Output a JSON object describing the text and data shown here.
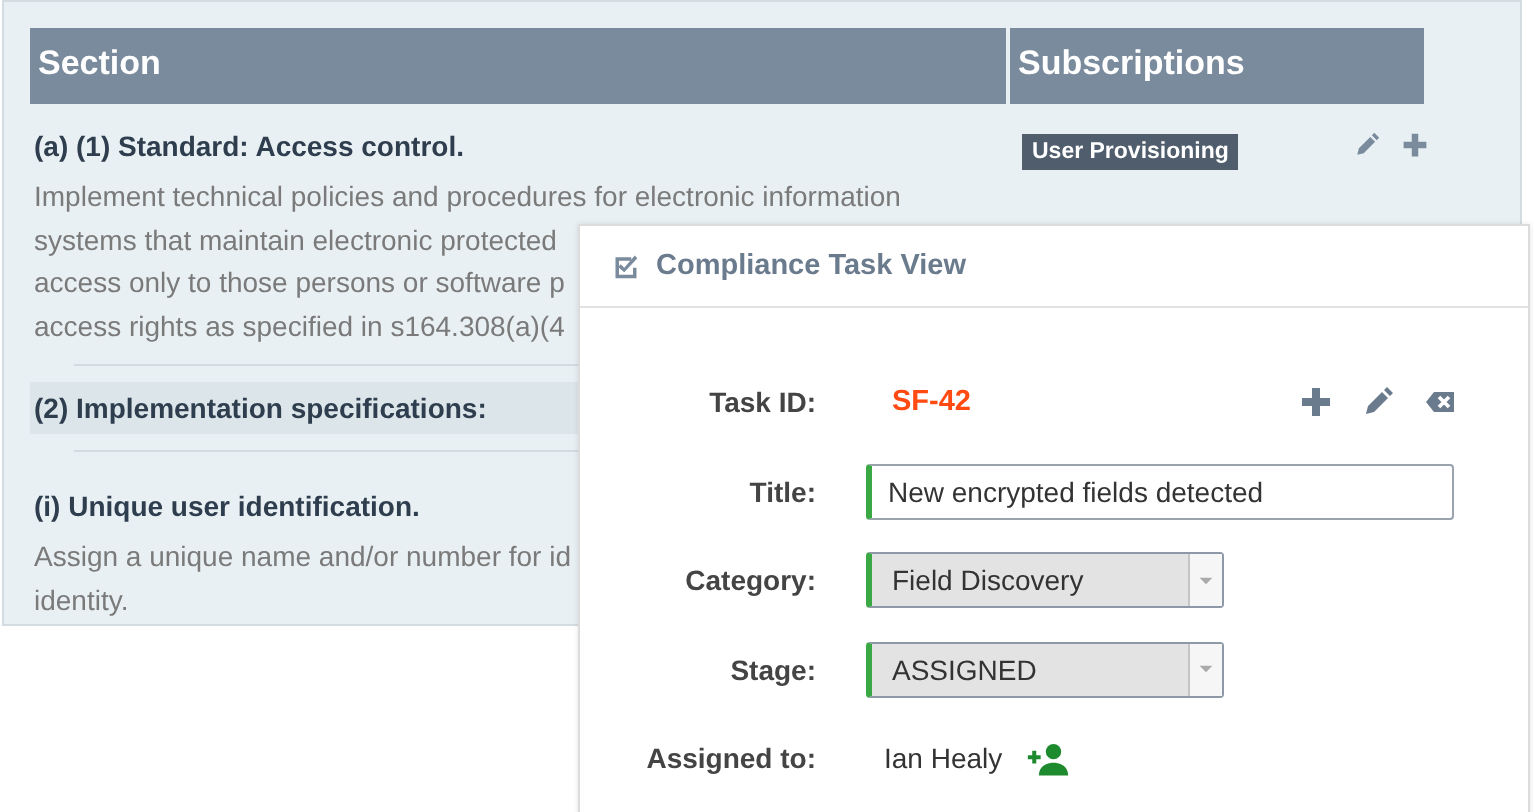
{
  "table": {
    "columns": [
      "Section",
      "Subscriptions"
    ],
    "rows": [
      {
        "kind": "standard",
        "title": "(a) (1) Standard: Access control.",
        "description_lines": [
          "Implement technical policies and procedures for electronic information",
          "systems that maintain electronic protected",
          "access only to those persons or software p",
          "access rights as specified in s164.308(a)(4"
        ],
        "tags": [
          "User Provisioning"
        ]
      },
      {
        "kind": "group",
        "title": "(2) Implementation specifications:"
      },
      {
        "kind": "standard",
        "title": "(i) Unique user identification.",
        "description_lines": [
          "Assign a unique name and/or number for id",
          "identity."
        ]
      }
    ]
  },
  "dialog": {
    "title": "Compliance Task View",
    "fields": [
      {
        "kind": "id",
        "label": "Task ID:",
        "value": "SF-42"
      },
      {
        "kind": "text",
        "label": "Title:",
        "value": "New encrypted fields detected"
      },
      {
        "kind": "select",
        "label": "Category:",
        "value": "Field Discovery"
      },
      {
        "kind": "select",
        "label": "Stage:",
        "value": "ASSIGNED"
      },
      {
        "kind": "person",
        "label": "Assigned to:",
        "value": "Ian Healy"
      }
    ]
  }
}
